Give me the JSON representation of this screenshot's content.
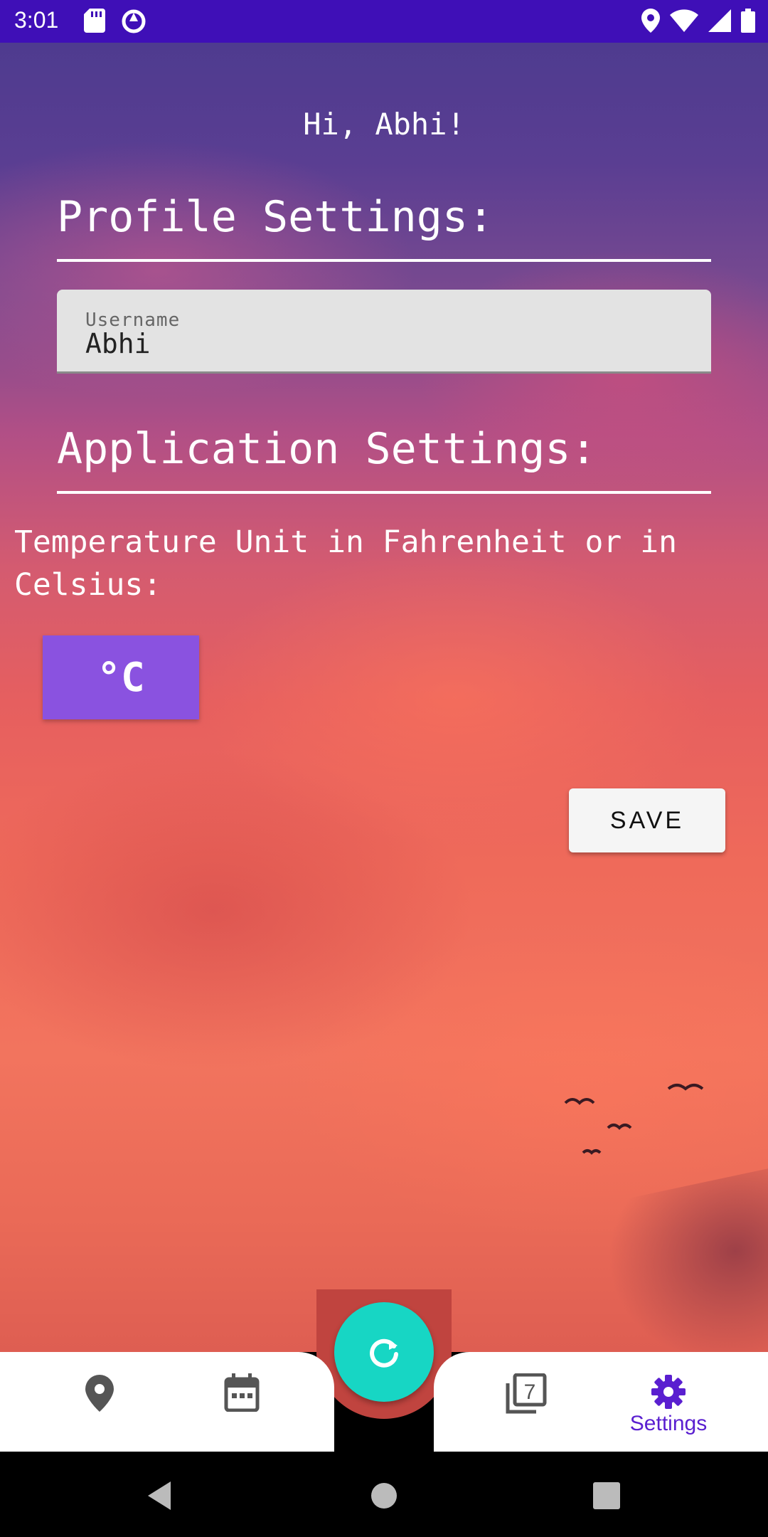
{
  "status_bar": {
    "time": "3:01",
    "left_icons": [
      "sd-card-icon",
      "data-saver-icon"
    ],
    "right_icons": [
      "location-icon",
      "wifi-icon",
      "signal-icon",
      "battery-icon"
    ]
  },
  "greeting": "Hi, Abhi!",
  "profile": {
    "title": "Profile Settings:",
    "username_label": "Username",
    "username_value": "Abhi"
  },
  "application": {
    "title": "Application Settings:",
    "temperature_prompt": "Temperature Unit in Fahrenheit or in Celsius:",
    "unit_toggle_label": "°C"
  },
  "save_label": "SAVE",
  "bottom_nav": {
    "items": [
      {
        "icon": "location-pin-icon",
        "label": ""
      },
      {
        "icon": "calendar-icon",
        "label": ""
      },
      {
        "icon": "refresh-icon",
        "label": ""
      },
      {
        "icon": "seven-day-icon",
        "label": ""
      },
      {
        "icon": "gear-icon",
        "label": "Settings"
      }
    ],
    "active": "Settings"
  },
  "colors": {
    "status_bar": "#3f0fb7",
    "accent": "#5a1fd0",
    "fab": "#17d6c4",
    "unit_toggle": "#8a52e0"
  }
}
